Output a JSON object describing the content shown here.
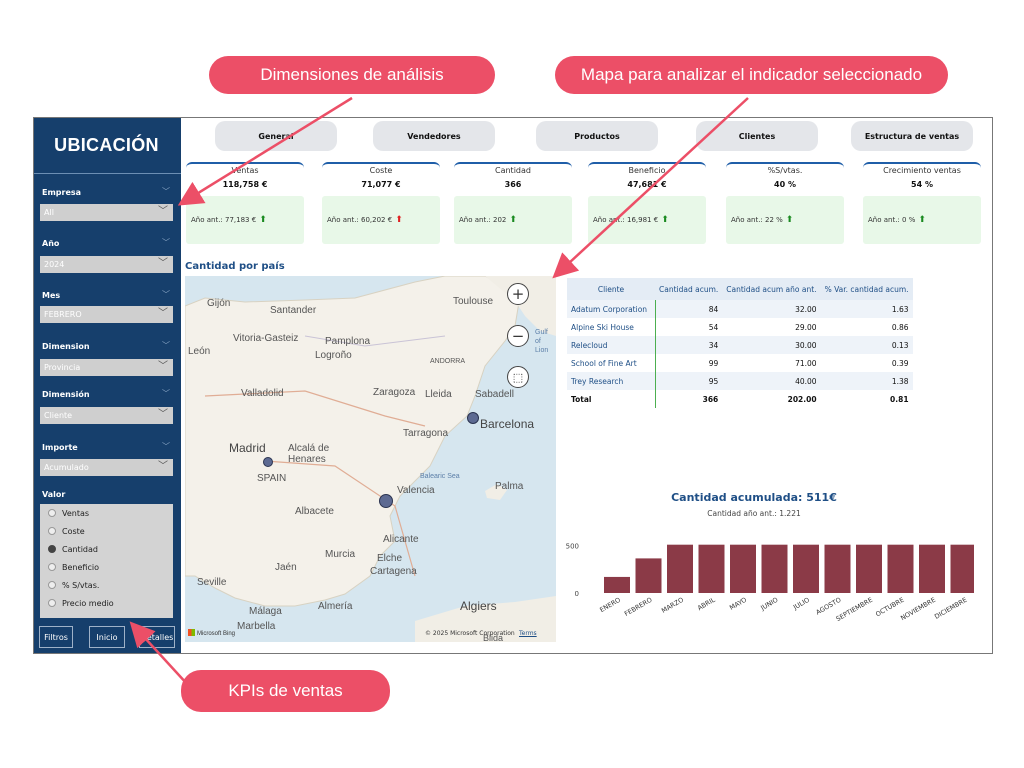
{
  "callouts": {
    "dimensiones": "Dimensiones de análisis",
    "mapa": "Mapa para analizar el indicador seleccionado",
    "kpis": "KPIs de ventas"
  },
  "sidebar": {
    "title": "UBICACIÓN",
    "filters": [
      {
        "label": "Empresa",
        "value": "All"
      },
      {
        "label": "Año",
        "value": "2024"
      },
      {
        "label": "Mes",
        "value": "FEBRERO"
      },
      {
        "label": "Dimension",
        "value": "Provincia"
      },
      {
        "label": "Dimensión",
        "value": "Cliente"
      },
      {
        "label": "Importe",
        "value": "Acumulado"
      }
    ],
    "valor_label": "Valor",
    "valor_options": [
      "Ventas",
      "Coste",
      "Cantidad",
      "Beneficio",
      "% S/vtas.",
      "Precio medio"
    ],
    "valor_selected": "Cantidad",
    "buttons": {
      "filtros": "Filtros",
      "inicio": "Inicio",
      "detalles": "Detalles"
    }
  },
  "tabs": [
    "General",
    "Vendedores",
    "Productos",
    "Clientes",
    "Estructura de ventas"
  ],
  "kpis": [
    {
      "label": "Ventas",
      "value": "118,758 €",
      "prev": "Año ant.: 77,183 €",
      "trend": "up"
    },
    {
      "label": "Coste",
      "value": "71,077 €",
      "prev": "Año ant.: 60,202 €",
      "trend": "down"
    },
    {
      "label": "Cantidad",
      "value": "366",
      "prev": "Año ant.: 202",
      "trend": "up"
    },
    {
      "label": "Beneficio",
      "value": "47,681 €",
      "prev": "Año ant.: 16,981 €",
      "trend": "up"
    },
    {
      "label": "%S/vtas.",
      "value": "40 %",
      "prev": "Año ant.: 22 %",
      "trend": "up"
    },
    {
      "label": "Crecimiento ventas",
      "value": "54 %",
      "prev": "Año ant.: 0 %",
      "trend": "up"
    }
  ],
  "map": {
    "title": "Cantidad por país",
    "labels": [
      "Gijón",
      "Santander",
      "Toulouse",
      "Vitoria-Gasteiz",
      "Pamplona",
      "León",
      "Logroño",
      "ANDORRA",
      "Valladolid",
      "Zaragoza",
      "Lleida",
      "Sabadell",
      "Barcelona",
      "Tarragona",
      "Madrid",
      "Alcalá de Henares",
      "SPAIN",
      "Balearic Sea",
      "Valencia",
      "Palma",
      "Albacete",
      "Alicante",
      "Murcia",
      "Elche",
      "Cartagena",
      "Jaén",
      "Seville",
      "Málaga",
      "Almería",
      "Marbella",
      "Algiers",
      "Gulf of Lion",
      "Blida"
    ],
    "copyright": "© 2025 Microsoft Corporation",
    "terms": "Terms",
    "brand": "Microsoft Bing"
  },
  "table": {
    "headers": [
      "Cliente",
      "Cantidad acum.",
      "Cantidad acum año ant.",
      "% Var. cantidad acum."
    ],
    "rows": [
      [
        "Adatum Corporation",
        "84",
        "32.00",
        "1.63"
      ],
      [
        "Alpine Ski House",
        "54",
        "29.00",
        "0.86"
      ],
      [
        "Relecloud",
        "34",
        "30.00",
        "0.13"
      ],
      [
        "School of Fine Art",
        "99",
        "71.00",
        "0.39"
      ],
      [
        "Trey Research",
        "95",
        "40.00",
        "1.38"
      ]
    ],
    "total": [
      "Total",
      "366",
      "202.00",
      "0.81"
    ]
  },
  "chart_data": {
    "type": "bar",
    "title": "Cantidad acumulada: 511€",
    "subtitle": "Cantidad año ant.: 1.221",
    "categories": [
      "ENERO",
      "FEBRERO",
      "MARZO",
      "ABRIL",
      "MAYO",
      "JUNIO",
      "JULIO",
      "AGOSTO",
      "SEPTIEMBRE",
      "OCTUBRE",
      "NOVIEMBRE",
      "DICIEMBRE"
    ],
    "values": [
      170,
      366,
      511,
      511,
      511,
      511,
      511,
      511,
      511,
      511,
      511,
      511
    ],
    "yticks": [
      "500",
      "0"
    ],
    "ylim": [
      0,
      550
    ],
    "color": "#8b3a47"
  }
}
